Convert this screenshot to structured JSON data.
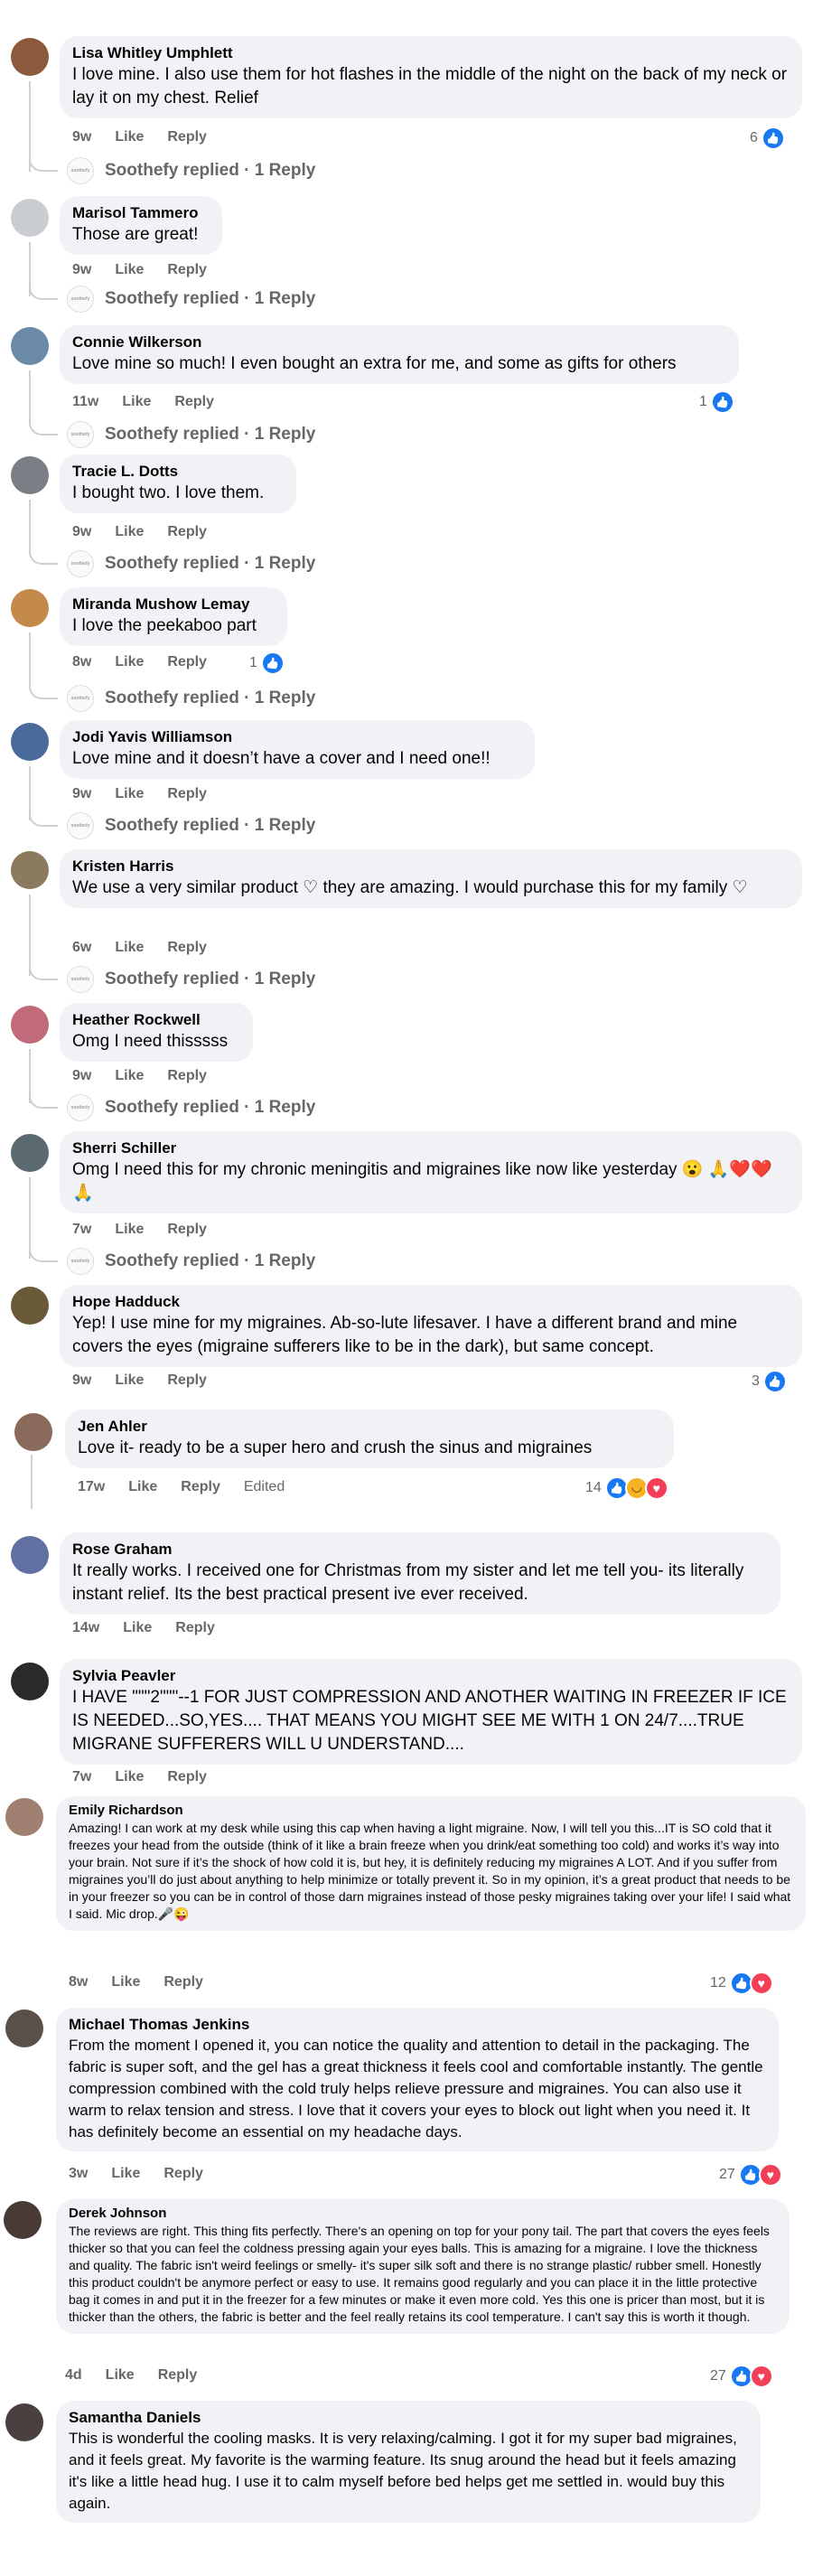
{
  "ui": {
    "like": "Like",
    "reply": "Reply",
    "replied_suffix": "Soothefy replied · 1 Reply",
    "soothefy_mark": "soothefy"
  },
  "comments": [
    {
      "name": "Lisa Whitley Umphlett",
      "text": "I love mine. I also use them for hot flashes in the middle of the night on the back of my neck or lay it on my chest. Relief",
      "time": "9w",
      "count": "6",
      "avatar_color": "#8b5a3c"
    },
    {
      "name": "Marisol Tammero",
      "text": "Those are great!",
      "time": "9w",
      "avatar_color": "#c9ccd1"
    },
    {
      "name": "Connie Wilkerson",
      "text": "Love mine so much! I even bought an extra for me, and some as gifts for others",
      "time": "11w",
      "count": "1",
      "avatar_color": "#6b8aa8"
    },
    {
      "name": "Tracie L. Dotts",
      "text": "I bought two. I love them.",
      "time": "9w",
      "avatar_color": "#7a7f86"
    },
    {
      "name": "Miranda Mushow Lemay",
      "text": "I love the peekaboo part",
      "time": "8w",
      "count": "1",
      "avatar_color": "#c48a4a"
    },
    {
      "name": "Jodi Yavis Williamson",
      "text": "Love mine and it doesn’t have a cover and I need one!!",
      "time": "9w",
      "avatar_color": "#4a6a9a"
    },
    {
      "name": "Kristen Harris",
      "text": "We use a very similar product ♡ they are amazing. I would purchase this for my family ♡",
      "time": "6w",
      "avatar_color": "#8c7a5e"
    },
    {
      "name": "Heather Rockwell",
      "text": "Omg I need thisssss",
      "time": "9w",
      "avatar_color": "#c06a7a"
    },
    {
      "name": "Sherri Schiller",
      "text": "Omg I need this for my chronic meningitis and migraines like now like yesterday 😮 🙏❤️❤️🙏",
      "time": "7w",
      "avatar_color": "#5a6a70"
    },
    {
      "name": "Hope Hadduck",
      "text": "Yep! I use mine for my migraines. Ab-so-lute lifesaver. I have a different brand and mine covers the eyes (migraine sufferers like to be in the dark), but same concept.",
      "time": "9w",
      "count": "3",
      "avatar_color": "#6a5a3a"
    },
    {
      "name": "Jen Ahler",
      "text": "Love it- ready to be a super hero and crush the sinus and migraines",
      "time": "17w",
      "edited": "Edited",
      "count": "14",
      "avatar_color": "#8a6a5a"
    },
    {
      "name": "Rose Graham",
      "text": "It really works. I received one for Christmas from my sister and let me tell you- its literally instant relief. Its the best practical present ive ever received.",
      "time": "14w",
      "avatar_color": "#6070a0"
    },
    {
      "name": "Sylvia Peavler",
      "text": "I HAVE \"\"\"2\"\"\"--1 FOR JUST COMPRESSION AND ANOTHER WAITING IN FREEZER IF ICE IS NEEDED...SO,YES.... THAT MEANS YOU MIGHT SEE ME WITH 1 ON 24/7....TRUE MIGRANE SUFFERERS WILL U UNDERSTAND....",
      "time": "7w",
      "avatar_color": "#2a2a2a"
    },
    {
      "name": "Emily Richardson",
      "text": "Amazing! I can work at my desk while using this cap when having a light migraine. Now, I will tell you this...IT is SO cold that it freezes your head from the outside (think of it like a brain freeze when you drink/eat something too cold) and works it’s way into your brain. Not sure if it’s the shock of how cold it is, but hey, it is definitely reducing my migraines A LOT. And if you suffer from migraines you’ll do just about anything to help minimize or totally prevent it. So in my opinion, it’s a great product that needs to be in your freezer so you can be in control of those darn migraines instead of those pesky migraines taking over your life! I said what I said. Mic drop.🎤😜",
      "time": "8w",
      "count": "12",
      "avatar_color": "#a08070"
    },
    {
      "name": "Michael Thomas Jenkins",
      "text": "From the moment I opened it, you can notice the quality and attention to detail in the packaging. The fabric is super soft, and the gel has a great thickness it feels cool and comfortable instantly. The gentle compression combined with the cold truly helps relieve pressure and migraines. You can also use it warm to relax tension and stress. I love that it covers your eyes to block out light when you need it. It has definitely become an essential on my headache days.",
      "time": "3w",
      "count": "27",
      "avatar_color": "#5a5048"
    },
    {
      "name": "Derek Johnson",
      "text": "The reviews are right. This thing fits perfectly. There's an opening on top for your pony tail. The part that covers the eyes feels thicker so that you can feel the coldness pressing again your eyes balls. This is amazing for a migraine. I love the thickness and quality. The fabric isn't weird feelings or smelly- it's super silk soft and there is no strange plastic/ rubber smell. Honestly this product couldn't be anymore perfect or easy to use. It remains good regularly and you can place it in the little protective bag it comes in and put it in the freezer for a few minutes or make it even more cold. Yes this one is pricer than most, but it is thicker than the others, the fabric is better and the feel really retains its cool temperature. I can't say this is worth it though.",
      "time": "4d",
      "count": "27",
      "avatar_color": "#4a3a36"
    },
    {
      "name": "Samantha Daniels",
      "text": "This is wonderful the cooling masks. It is very relaxing/calming. I got it for my super bad migraines, and it feels great. My favorite is the warming feature. Its snug around the head but it feels amazing it's like a little head hug. I use it to calm myself before bed helps get me settled in. would buy this again.",
      "time": "",
      "avatar_color": "#4a4040"
    }
  ]
}
